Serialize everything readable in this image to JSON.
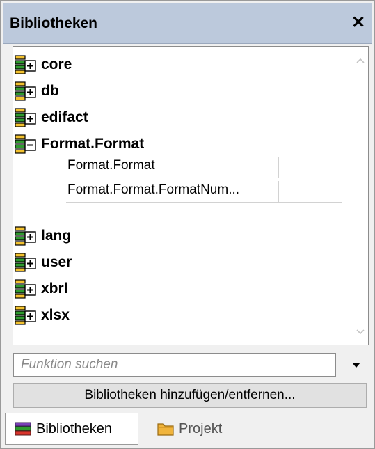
{
  "panel": {
    "title": "Bibliotheken",
    "close_glyph": "✕"
  },
  "libraries_before": [
    {
      "name": "core",
      "icon": "library-expand-icon"
    },
    {
      "name": "db",
      "icon": "library-expand-icon"
    },
    {
      "name": "edifact",
      "icon": "library-expand-icon"
    },
    {
      "name": "Format.Format",
      "icon": "library-collapse-icon"
    }
  ],
  "functions": [
    {
      "name": "Format.Format"
    },
    {
      "name": "Format.Format.FormatNum..."
    }
  ],
  "libraries_after": [
    {
      "name": "lang",
      "icon": "library-expand-icon"
    },
    {
      "name": "user",
      "icon": "library-expand-icon"
    },
    {
      "name": "xbrl",
      "icon": "library-expand-icon"
    },
    {
      "name": "xlsx",
      "icon": "library-expand-icon"
    }
  ],
  "search": {
    "placeholder": "Funktion suchen",
    "value": ""
  },
  "add_remove_label": "Bibliotheken hinzufügen/entfernen...",
  "tabs": [
    {
      "label": "Bibliotheken",
      "icon": "books-icon",
      "active": true
    },
    {
      "label": "Projekt",
      "icon": "folder-icon",
      "active": false
    }
  ],
  "colors": {
    "titlebar": "#bcc9dc",
    "icon_green": "#2e9b2e",
    "icon_yellow": "#f2c12e",
    "folder": "#f0b43c"
  }
}
